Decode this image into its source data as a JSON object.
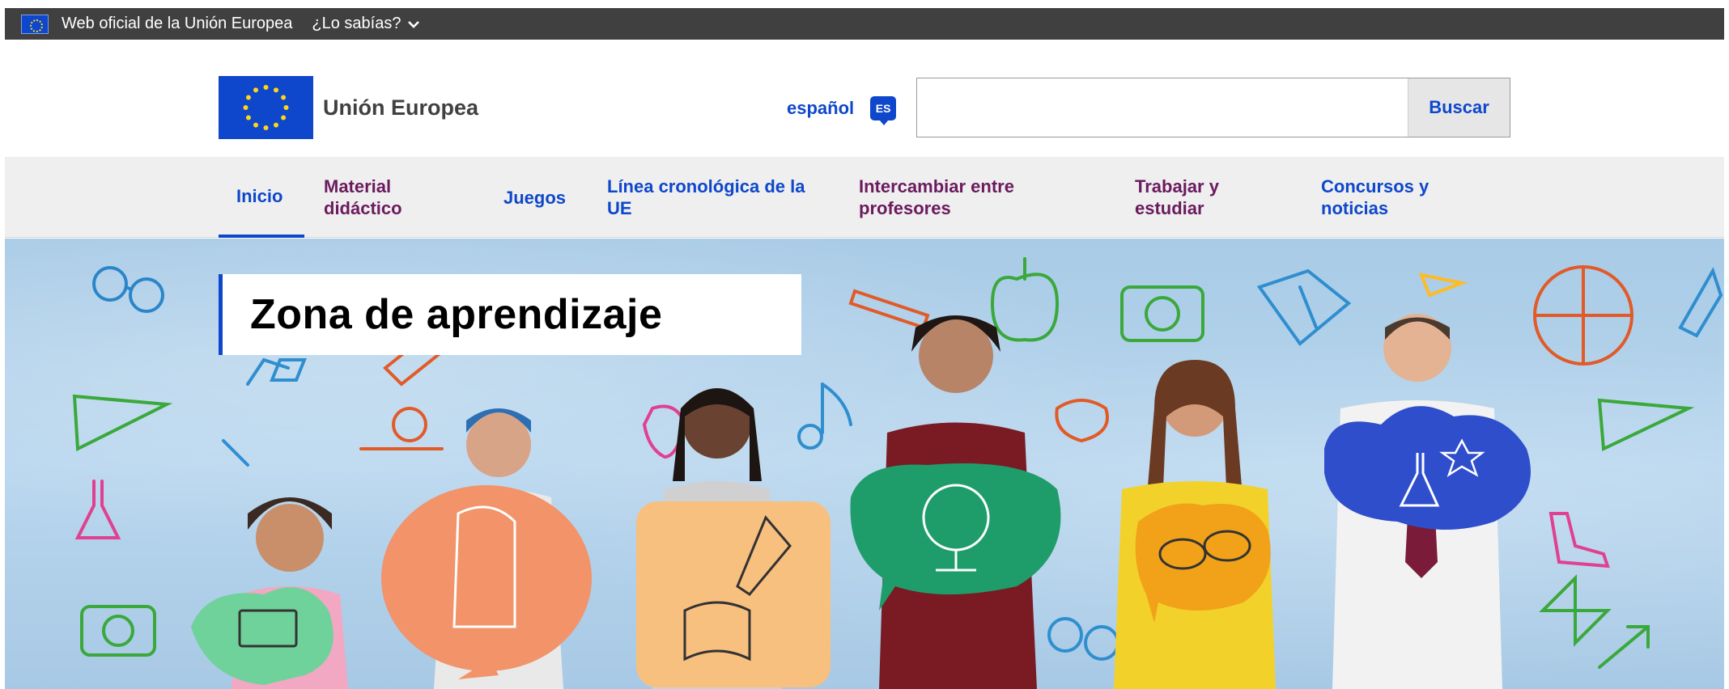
{
  "topbar": {
    "official_text": "Web oficial de la Unión Europea",
    "didyouknow": "¿Lo sabías?"
  },
  "header": {
    "site_name": "Unión Europea",
    "language_label": "español",
    "language_code": "ES",
    "search_placeholder": "",
    "search_button": "Buscar"
  },
  "nav": {
    "items": [
      {
        "line1": "Inicio",
        "line2": ""
      },
      {
        "line1": "Material",
        "line2": "didáctico"
      },
      {
        "line1": "Juegos",
        "line2": ""
      },
      {
        "line1": "Línea cronológica de la",
        "line2": "UE"
      },
      {
        "line1": "Intercambiar entre",
        "line2": "profesores"
      },
      {
        "line1": "Trabajar y",
        "line2": "estudiar"
      },
      {
        "line1": "Concursos y",
        "line2": "noticias"
      }
    ]
  },
  "hero": {
    "title": "Zona de aprendizaje"
  },
  "colors": {
    "eu_blue": "#0e47cb",
    "top_bar": "#404040",
    "nav_bg": "#efefef",
    "nav_purple": "#6a1b5e",
    "eu_yellow": "#ffd617"
  },
  "icons": [
    "eu-flag-icon",
    "chevron-down-icon",
    "language-badge-icon"
  ]
}
